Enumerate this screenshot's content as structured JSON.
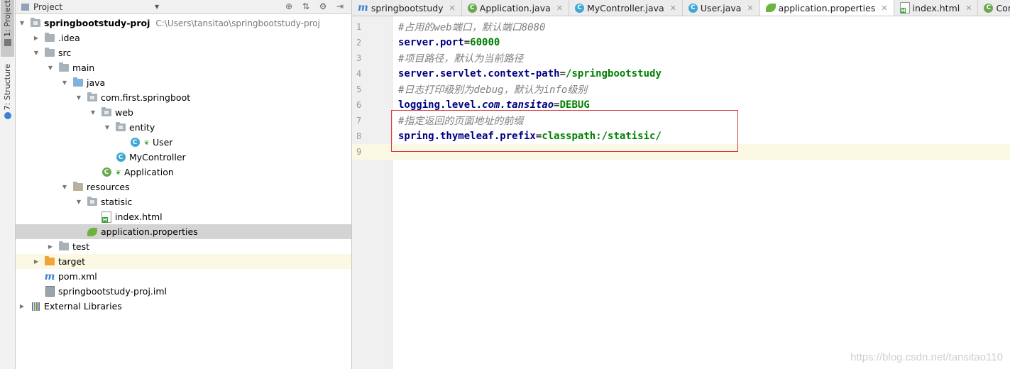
{
  "side": {
    "project_tab": "1: Project",
    "structure_tab": "7: Structure"
  },
  "project_panel": {
    "title": "Project"
  },
  "tree": [
    {
      "label": "springbootstudy-proj",
      "hint": "C:\\Users\\tansitao\\springbootstudy-proj",
      "depth": 0,
      "arrow": "down",
      "icon": "folder-module",
      "bold": true
    },
    {
      "label": ".idea",
      "depth": 1,
      "arrow": "right",
      "icon": "folder"
    },
    {
      "label": "src",
      "depth": 1,
      "arrow": "down",
      "icon": "folder"
    },
    {
      "label": "main",
      "depth": 2,
      "arrow": "down",
      "icon": "folder"
    },
    {
      "label": "java",
      "depth": 3,
      "arrow": "down",
      "icon": "folder-blue"
    },
    {
      "label": "com.first.springboot",
      "depth": 4,
      "arrow": "down",
      "icon": "package"
    },
    {
      "label": "web",
      "depth": 5,
      "arrow": "down",
      "icon": "package"
    },
    {
      "label": "entity",
      "depth": 6,
      "arrow": "down",
      "icon": "package"
    },
    {
      "label": "User",
      "depth": 7,
      "arrow": "none",
      "icon": "class",
      "leaf": true
    },
    {
      "label": "MyController",
      "depth": 6,
      "arrow": "none",
      "icon": "class"
    },
    {
      "label": "Application",
      "depth": 5,
      "arrow": "none",
      "icon": "app-class",
      "leaf": true
    },
    {
      "label": "resources",
      "depth": 3,
      "arrow": "down",
      "icon": "resources"
    },
    {
      "label": "statisic",
      "depth": 4,
      "arrow": "down",
      "icon": "package"
    },
    {
      "label": "index.html",
      "depth": 5,
      "arrow": "none",
      "icon": "html"
    },
    {
      "label": "application.properties",
      "depth": 4,
      "arrow": "none",
      "icon": "spring",
      "selected": true
    },
    {
      "label": "test",
      "depth": 2,
      "arrow": "right",
      "icon": "folder"
    },
    {
      "label": "target",
      "depth": 1,
      "arrow": "right",
      "icon": "folder-orange",
      "target": true
    },
    {
      "label": "pom.xml",
      "depth": 1,
      "arrow": "none",
      "icon": "maven"
    },
    {
      "label": "springbootstudy-proj.iml",
      "depth": 1,
      "arrow": "none",
      "icon": "iml"
    },
    {
      "label": "External Libraries",
      "depth": 0,
      "arrow": "right",
      "icon": "libraries"
    }
  ],
  "tabs": [
    {
      "label": "springbootstudy",
      "icon": "maven"
    },
    {
      "label": "Application.java",
      "icon": "app-class"
    },
    {
      "label": "MyController.java",
      "icon": "class"
    },
    {
      "label": "User.java",
      "icon": "class"
    },
    {
      "label": "application.properties",
      "icon": "spring",
      "active": true
    },
    {
      "label": "index.html",
      "icon": "html"
    },
    {
      "label": "ConfigFileAp",
      "icon": "app-class",
      "cut": true
    }
  ],
  "editor": {
    "lines": [
      {
        "n": "1",
        "parts": [
          {
            "t": "#占用的",
            "c": "cmt"
          },
          {
            "t": "web",
            "c": "cmt"
          },
          {
            "t": "端口，默认端口",
            "c": "cmt"
          },
          {
            "t": "8080",
            "c": "cmt"
          }
        ]
      },
      {
        "n": "2",
        "parts": [
          {
            "t": "server.port",
            "c": "key"
          },
          {
            "t": "=",
            "c": "eq"
          },
          {
            "t": "60000",
            "c": "val"
          }
        ]
      },
      {
        "n": "3",
        "parts": [
          {
            "t": "#项目路径，默认为当前路径",
            "c": "cmt"
          }
        ]
      },
      {
        "n": "4",
        "parts": [
          {
            "t": "server.servlet.context-path",
            "c": "key"
          },
          {
            "t": "=",
            "c": "eq"
          },
          {
            "t": "/springbootstudy",
            "c": "val"
          }
        ]
      },
      {
        "n": "5",
        "parts": [
          {
            "t": "#日志打印级别为",
            "c": "cmt"
          },
          {
            "t": "debug",
            "c": "cmt"
          },
          {
            "t": "，默认为",
            "c": "cmt"
          },
          {
            "t": "info",
            "c": "cmt"
          },
          {
            "t": "级别",
            "c": "cmt"
          }
        ]
      },
      {
        "n": "6",
        "parts": [
          {
            "t": "logging.level.",
            "c": "key"
          },
          {
            "t": "com.tansitao",
            "c": "italicval"
          },
          {
            "t": "=",
            "c": "eq"
          },
          {
            "t": "DEBUG",
            "c": "val"
          }
        ]
      },
      {
        "n": "7",
        "parts": [
          {
            "t": "#指定返回的页面地址的前缀",
            "c": "cmt"
          }
        ]
      },
      {
        "n": "8",
        "parts": [
          {
            "t": "spring.thymeleaf.prefix",
            "c": "key"
          },
          {
            "t": "=",
            "c": "eq"
          },
          {
            "t": "classpath:/statisic/",
            "c": "val"
          }
        ]
      },
      {
        "n": "9",
        "parts": [],
        "current": true
      }
    ]
  },
  "watermark": "https://blog.csdn.net/tansitao110",
  "colors": {
    "highlight": "#d9363a",
    "selection": "#d4d4d4",
    "current_line": "#fbf8e3"
  }
}
